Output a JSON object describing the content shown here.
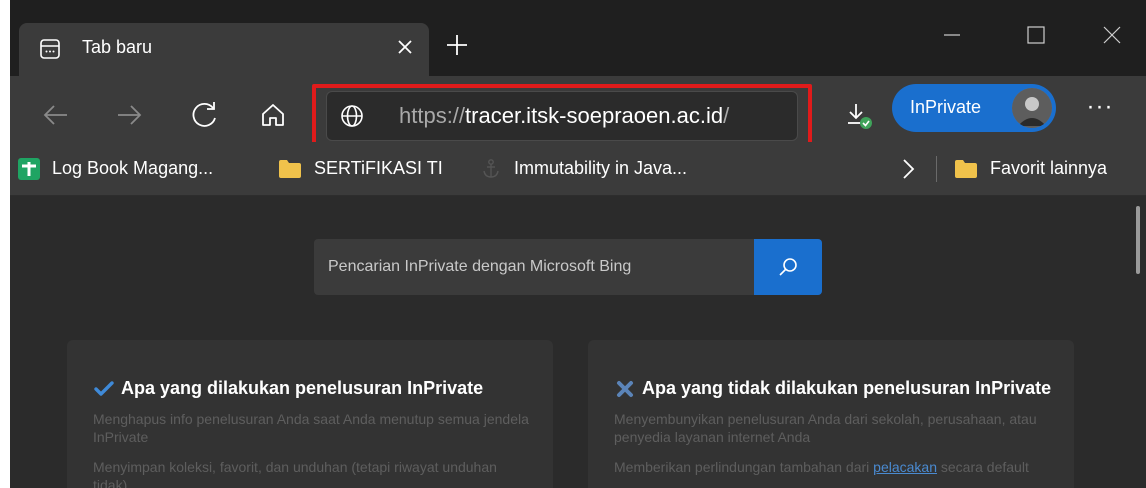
{
  "tab": {
    "title": "Tab baru"
  },
  "toolbar": {
    "url_scheme": "https://",
    "url_host": "tracer.itsk-soepraoen.ac.id",
    "url_path": "/",
    "inprivate_label": "InPrivate",
    "more_label": "···"
  },
  "bookmarks": [
    {
      "label": "Log Book Magang...",
      "icon": "green-plus-icon"
    },
    {
      "label": "SERTiFIKASI TI",
      "icon": "folder-icon"
    },
    {
      "label": "Immutability in Java...",
      "icon": "anchor-icon"
    }
  ],
  "bookmarks_more": {
    "label": "Favorit lainnya",
    "icon": "folder-icon"
  },
  "search": {
    "placeholder": "Pencarian InPrivate dengan Microsoft Bing"
  },
  "cards": {
    "does": {
      "title": "Apa yang dilakukan penelusuran InPrivate",
      "items": [
        "Menghapus info penelusuran Anda saat Anda menutup semua jendela InPrivate",
        "Menyimpan koleksi, favorit, dan unduhan (tetapi riwayat unduhan tidak)"
      ]
    },
    "doesnt": {
      "title": "Apa yang tidak dilakukan penelusuran InPrivate",
      "items": [
        "Menyembunyikan penelusuran Anda dari sekolah, perusahaan, atau penyedia layanan internet Anda"
      ],
      "item2_before": "Memberikan perlindungan tambahan dari ",
      "item2_link": "pelacakan",
      "item2_after": " secara default"
    }
  },
  "colors": {
    "accent": "#1a6fce",
    "highlight_border": "#e01b1b",
    "background": "#2b2b2b"
  }
}
